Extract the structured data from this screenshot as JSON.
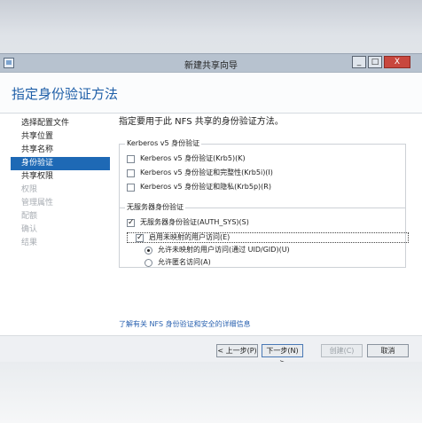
{
  "window": {
    "title": "新建共享向导",
    "controls": {
      "minimize": "_",
      "maximize": "□",
      "close": "X"
    }
  },
  "header": {
    "title": "指定身份验证方法"
  },
  "nav": {
    "items": [
      {
        "label": "选择配置文件",
        "state": "normal"
      },
      {
        "label": "共享位置",
        "state": "normal"
      },
      {
        "label": "共享名称",
        "state": "normal"
      },
      {
        "label": "身份验证",
        "state": "active"
      },
      {
        "label": "共享权限",
        "state": "normal"
      },
      {
        "label": "权限",
        "state": "disabled"
      },
      {
        "label": "管理属性",
        "state": "disabled"
      },
      {
        "label": "配额",
        "state": "disabled"
      },
      {
        "label": "确认",
        "state": "disabled"
      },
      {
        "label": "结果",
        "state": "disabled"
      }
    ]
  },
  "main": {
    "intro": "指定要用于此 NFS 共享的身份验证方法。",
    "kerberos": {
      "legend": "Kerberos v5 身份验证",
      "options": [
        {
          "label": "Kerberos v5 身份验证(Krb5)(K)",
          "checked": false
        },
        {
          "label": "Kerberos v5 身份验证和完整性(Krb5i)(I)",
          "checked": false
        },
        {
          "label": "Kerberos v5 身份验证和隐私(Krb5p)(R)",
          "checked": false
        }
      ]
    },
    "no_server": {
      "legend": "无服务器身份验证",
      "auth_sys": {
        "label": "无服务器身份验证(AUTH_SYS)(S)",
        "checked": true
      },
      "unmapped": {
        "label": "启用未映射的用户访问(E)",
        "checked": true
      },
      "radios": [
        {
          "label": "允许未映射的用户访问(通过 UID/GID)(U)",
          "checked": true
        },
        {
          "label": "允许匿名访问(A)",
          "checked": false
        }
      ]
    },
    "help_link": "了解有关 NFS 身份验证和安全的详细信息"
  },
  "footer": {
    "prev": "< 上一步(P)",
    "next": "下一步(N) >",
    "create": "创建(C)",
    "cancel": "取消"
  },
  "colors": {
    "accent": "#1e69b5",
    "title_blue": "#1f5fa8",
    "link": "#2a62b0"
  }
}
